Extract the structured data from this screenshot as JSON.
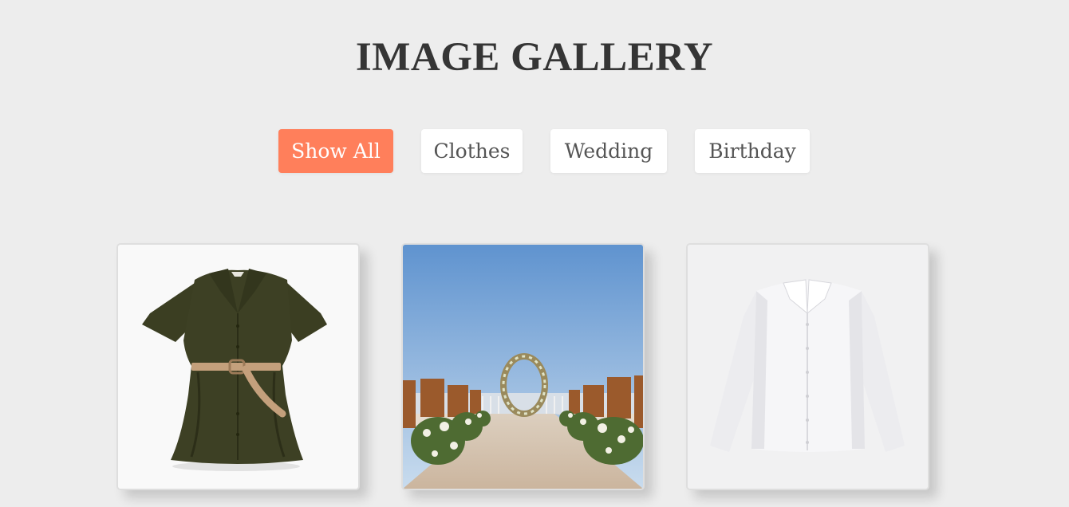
{
  "header": {
    "title": "IMAGE GALLERY"
  },
  "filters": [
    {
      "label": "Show All",
      "active": true
    },
    {
      "label": "Clothes",
      "active": false
    },
    {
      "label": "Wedding",
      "active": false
    },
    {
      "label": "Birthday",
      "active": false
    }
  ],
  "colors": {
    "page_background": "#ededed",
    "title": "#353535",
    "accent": "#ff7f5b",
    "button_background": "#ffffff",
    "button_text": "#555555"
  },
  "gallery": {
    "items": [
      {
        "category": "Clothes",
        "image": "olive-belted-shirt-dress-photo"
      },
      {
        "category": "Wedding",
        "image": "wedding-floral-arch-ceremony-photo"
      },
      {
        "category": "Clothes",
        "image": "white-button-down-shirt-photo"
      }
    ]
  }
}
